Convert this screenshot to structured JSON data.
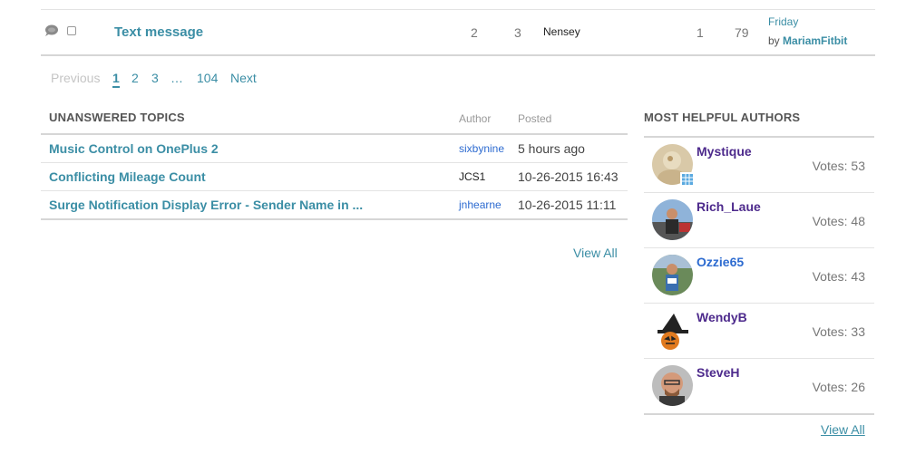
{
  "topic_row": {
    "title": "Text message",
    "stat_a": "2",
    "stat_b": "3",
    "author": "Nensey",
    "stat_c": "1",
    "stat_d": "79",
    "last_post_day": "Friday",
    "last_post_by_prefix": "by",
    "last_post_by": "MariamFitbit"
  },
  "pagination": {
    "previous": "Previous",
    "pages": [
      "1",
      "2",
      "3"
    ],
    "ellipsis": "…",
    "last_page": "104",
    "next": "Next"
  },
  "unanswered": {
    "heading": "UNANSWERED TOPICS",
    "col_author": "Author",
    "col_posted": "Posted",
    "rows": [
      {
        "title": "Music Control on OnePlus 2",
        "author": "sixbynine",
        "posted": "5 hours ago"
      },
      {
        "title": "Conflicting Mileage Count",
        "author": "JCS1",
        "posted": "10-26-2015 16:43"
      },
      {
        "title": "Surge Notification Display Error - Sender Name in ...",
        "author": "jnhearne",
        "posted": "10-26-2015 11:11"
      }
    ],
    "view_all": "View All"
  },
  "helpful": {
    "heading": "MOST HELPFUL AUTHORS",
    "authors": [
      {
        "name": "Mystique",
        "votes": "Votes: 53"
      },
      {
        "name": "Rich_Laue",
        "votes": "Votes: 48"
      },
      {
        "name": "Ozzie65",
        "votes": "Votes: 43"
      },
      {
        "name": "WendyB",
        "votes": "Votes: 33"
      },
      {
        "name": "SteveH",
        "votes": "Votes: 26"
      }
    ],
    "view_all": "View All"
  },
  "colors": {
    "link_teal": "#3b8ea5",
    "link_blue": "#2d6bd0",
    "name_purple": "#4d2a8c"
  },
  "icons": [
    "speech-bubble-icon",
    "checkbox-icon",
    "badge-icon"
  ]
}
